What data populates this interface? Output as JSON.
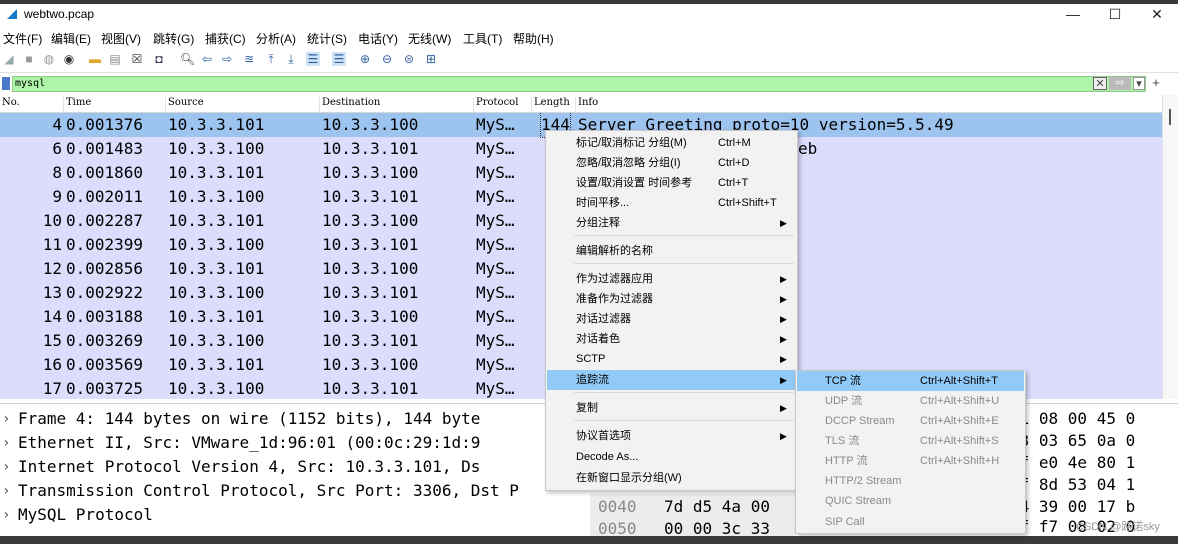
{
  "window": {
    "title": "webtwo.pcap",
    "minimize": "—",
    "maximize": "☐",
    "close": "✕"
  },
  "menubar": {
    "items": [
      "文件(F)",
      "编辑(E)",
      "视图(V)",
      "跳转(G)",
      "捕获(C)",
      "分析(A)",
      "统计(S)",
      "电话(Y)",
      "无线(W)",
      "工具(T)",
      "帮助(H)"
    ]
  },
  "filter": {
    "value": "mysql",
    "clear": "✕",
    "apply": "⇨",
    "dropdown": "▾",
    "add": "+"
  },
  "columns": [
    "No.",
    "Time",
    "Source",
    "Destination",
    "Protocol",
    "Length",
    "Info"
  ],
  "packets": [
    {
      "no": "4",
      "time": "0.001376",
      "src": "10.3.3.101",
      "dst": "10.3.3.100",
      "proto": "MyS…",
      "len": "144",
      "info": "Server Greeting  proto=10 version=5.5.49"
    },
    {
      "no": "6",
      "time": "0.001483",
      "src": "10.3.3.100",
      "dst": "10.3.3.101",
      "proto": "MyS…",
      "len": "",
      "info": "eb"
    },
    {
      "no": "8",
      "time": "0.001860",
      "src": "10.3.3.101",
      "dst": "10.3.3.100",
      "proto": "MyS…",
      "len": "",
      "info": ""
    },
    {
      "no": "9",
      "time": "0.002011",
      "src": "10.3.3.100",
      "dst": "10.3.3.101",
      "proto": "MyS…",
      "len": "",
      "info": ""
    },
    {
      "no": "10",
      "time": "0.002287",
      "src": "10.3.3.101",
      "dst": "10.3.3.100",
      "proto": "MyS…",
      "len": "",
      "info": ""
    },
    {
      "no": "11",
      "time": "0.002399",
      "src": "10.3.3.100",
      "dst": "10.3.3.101",
      "proto": "MyS…",
      "len": "",
      "info": ""
    },
    {
      "no": "12",
      "time": "0.002856",
      "src": "10.3.3.101",
      "dst": "10.3.3.100",
      "proto": "MyS…",
      "len": "",
      "info": ""
    },
    {
      "no": "13",
      "time": "0.002922",
      "src": "10.3.3.100",
      "dst": "10.3.3.101",
      "proto": "MyS…",
      "len": "",
      "info": ""
    },
    {
      "no": "14",
      "time": "0.003188",
      "src": "10.3.3.101",
      "dst": "10.3.3.100",
      "proto": "MyS…",
      "len": "",
      "info": ""
    },
    {
      "no": "15",
      "time": "0.003269",
      "src": "10.3.3.100",
      "dst": "10.3.3.101",
      "proto": "MyS…",
      "len": "",
      "info": ""
    },
    {
      "no": "16",
      "time": "0.003569",
      "src": "10.3.3.101",
      "dst": "10.3.3.100",
      "proto": "MyS…",
      "len": "",
      "info": ""
    },
    {
      "no": "17",
      "time": "0.003725",
      "src": "10.3.3.100",
      "dst": "10.3.3.101",
      "proto": "MyS…",
      "len": "",
      "info": ""
    }
  ],
  "details": [
    "Frame 4: 144 bytes on wire (1152 bits), 144 byte",
    "Ethernet II, Src: VMware_1d:96:01 (00:0c:29:1d:9",
    "Internet Protocol Version 4, Src: 10.3.3.101, Ds",
    "Transmission Control Protocol, Src Port: 3306, Dst P",
    "MySQL Protocol"
  ],
  "bytes": {
    "right_column": [
      "01 08 00 45 0",
      "03 03 65 0a 0",
      "af e0 4e 80 1",
      "ff 8d 53 04 1",
      "34 39 00 17 b",
      "ff f7 08 02 0"
    ],
    "rows": [
      {
        "offset": "0040",
        "hex": "7d d5 4a 00"
      },
      {
        "offset": "0050",
        "hex": "00 00 3c 33"
      }
    ]
  },
  "context_menu": {
    "items": [
      {
        "label": "标记/取消标记 分组(M)",
        "shortcut": "Ctrl+M",
        "arrow": ""
      },
      {
        "label": "忽略/取消忽略 分组(I)",
        "shortcut": "Ctrl+D",
        "arrow": ""
      },
      {
        "label": "设置/取消设置 时间参考",
        "shortcut": "Ctrl+T",
        "arrow": ""
      },
      {
        "label": "时间平移...",
        "shortcut": "Ctrl+Shift+T",
        "arrow": ""
      },
      {
        "label": "分组注释",
        "shortcut": "",
        "arrow": "▶"
      },
      {
        "label": "编辑解析的名称",
        "shortcut": "",
        "arrow": ""
      },
      {
        "label": "作为过滤器应用",
        "shortcut": "",
        "arrow": "▶"
      },
      {
        "label": "准备作为过滤器",
        "shortcut": "",
        "arrow": "▶"
      },
      {
        "label": "对话过滤器",
        "shortcut": "",
        "arrow": "▶"
      },
      {
        "label": "对话着色",
        "shortcut": "",
        "arrow": "▶"
      },
      {
        "label": "SCTP",
        "shortcut": "",
        "arrow": "▶"
      },
      {
        "label": "追踪流",
        "shortcut": "",
        "arrow": "▶"
      },
      {
        "label": "复制",
        "shortcut": "",
        "arrow": "▶"
      },
      {
        "label": "协议首选项",
        "shortcut": "",
        "arrow": "▶"
      },
      {
        "label": "Decode As...",
        "shortcut": "",
        "arrow": ""
      },
      {
        "label": "在新窗口显示分组(W)",
        "shortcut": "",
        "arrow": ""
      }
    ]
  },
  "follow_stream_menu": {
    "items": [
      {
        "label": "TCP 流",
        "shortcut": "Ctrl+Alt+Shift+T"
      },
      {
        "label": "UDP 流",
        "shortcut": "Ctrl+Alt+Shift+U"
      },
      {
        "label": "DCCP Stream",
        "shortcut": "Ctrl+Alt+Shift+E"
      },
      {
        "label": "TLS 流",
        "shortcut": "Ctrl+Alt+Shift+S"
      },
      {
        "label": "HTTP 流",
        "shortcut": "Ctrl+Alt+Shift+H"
      },
      {
        "label": "HTTP/2 Stream",
        "shortcut": ""
      },
      {
        "label": "QUIC Stream",
        "shortcut": ""
      },
      {
        "label": "SIP Call",
        "shortcut": ""
      }
    ]
  },
  "watermark": "CSDN @路诺sky"
}
